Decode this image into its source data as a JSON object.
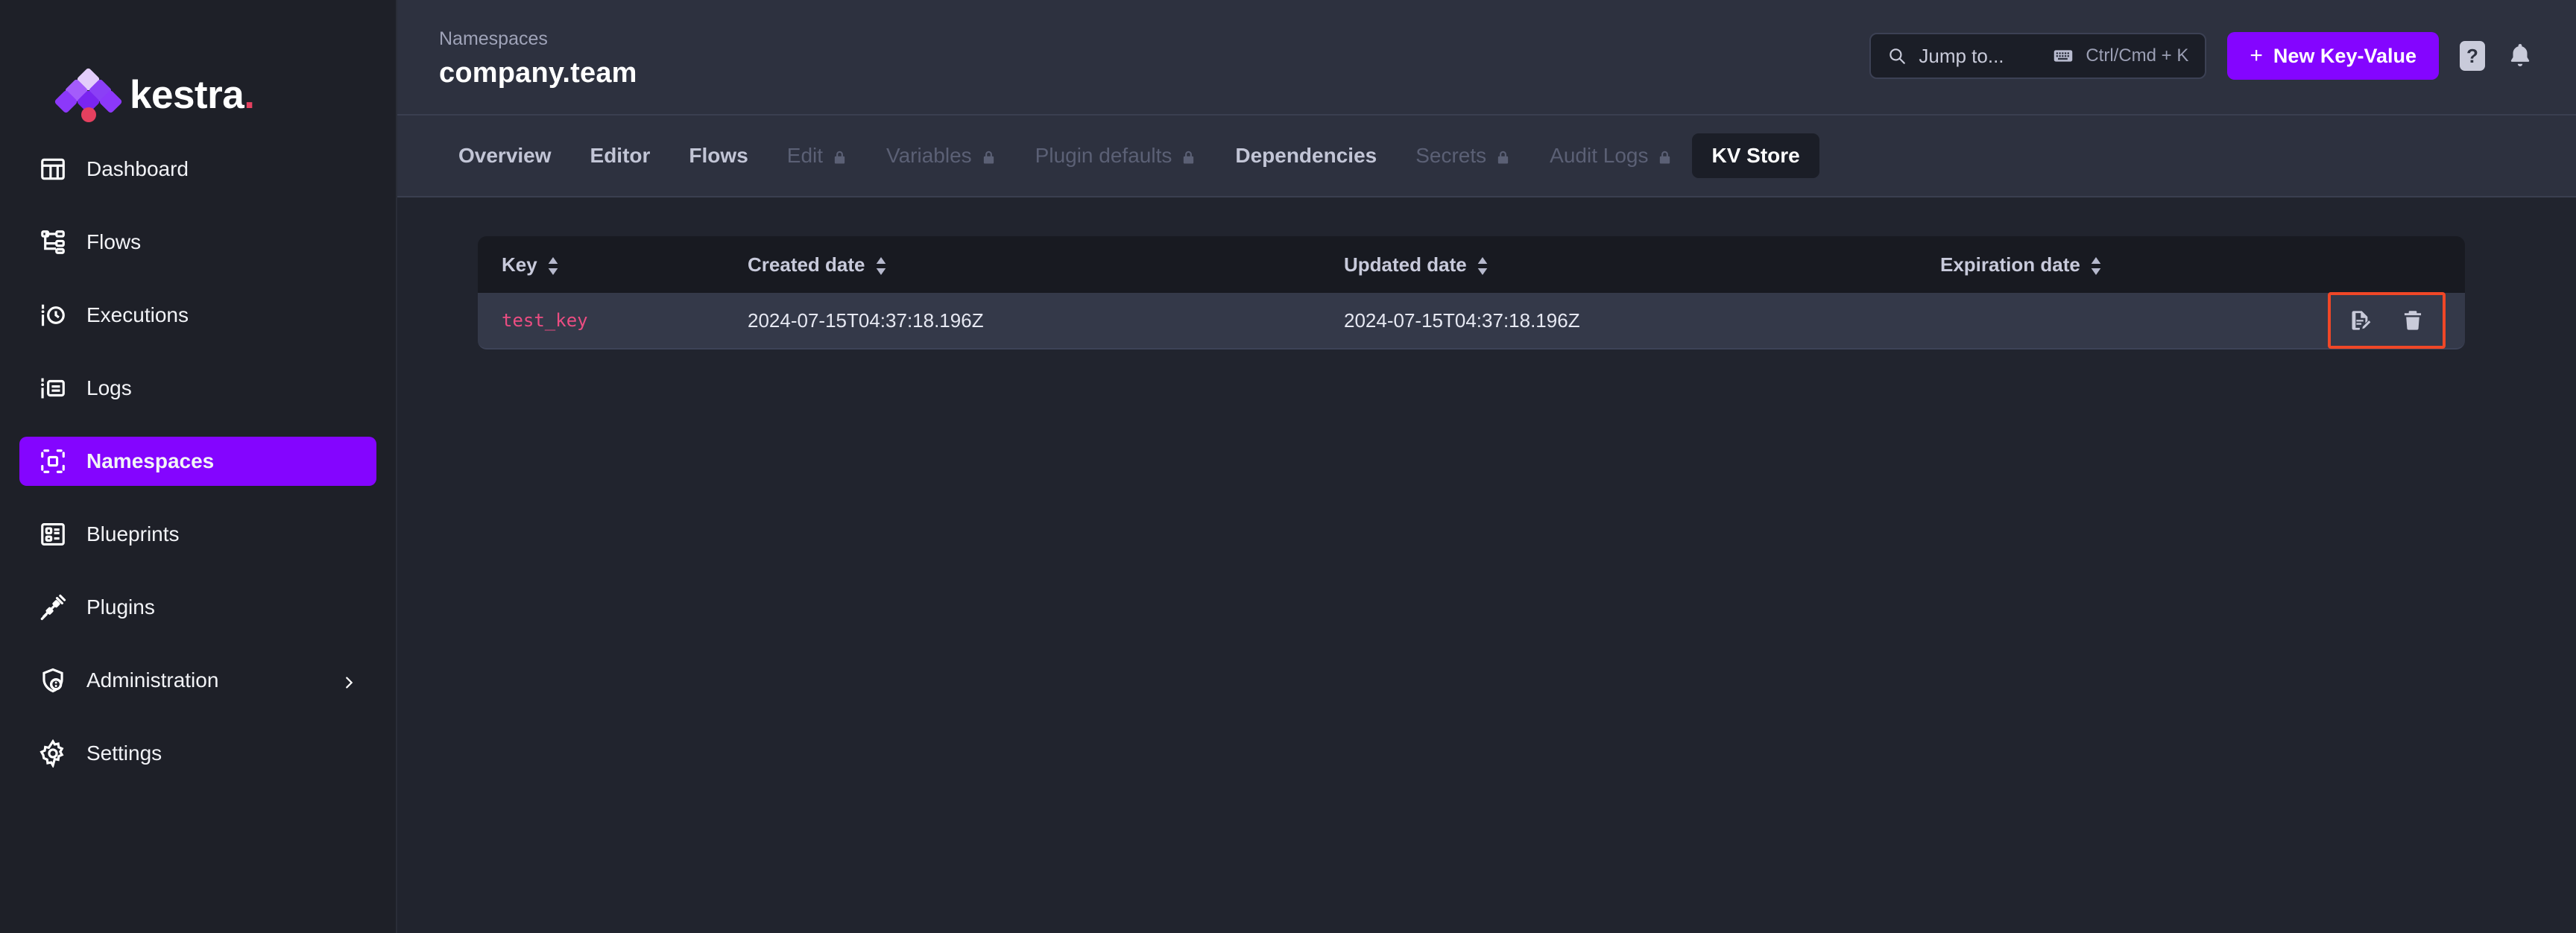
{
  "brand": {
    "name": "kestra",
    "accent_purple": "#8405ff",
    "accent_pink": "#e5405f"
  },
  "sidebar": {
    "items": [
      {
        "label": "Dashboard",
        "icon": "dashboard-icon",
        "active": false,
        "chevron": false
      },
      {
        "label": "Flows",
        "icon": "flows-icon",
        "active": false,
        "chevron": false
      },
      {
        "label": "Executions",
        "icon": "executions-icon",
        "active": false,
        "chevron": false
      },
      {
        "label": "Logs",
        "icon": "logs-icon",
        "active": false,
        "chevron": false
      },
      {
        "label": "Namespaces",
        "icon": "namespaces-icon",
        "active": true,
        "chevron": false
      },
      {
        "label": "Blueprints",
        "icon": "blueprints-icon",
        "active": false,
        "chevron": false
      },
      {
        "label": "Plugins",
        "icon": "plugins-icon",
        "active": false,
        "chevron": false
      },
      {
        "label": "Administration",
        "icon": "administration-icon",
        "active": false,
        "chevron": true
      },
      {
        "label": "Settings",
        "icon": "settings-icon",
        "active": false,
        "chevron": false
      }
    ]
  },
  "header": {
    "breadcrumb": "Namespaces",
    "title": "company.team",
    "search": {
      "placeholder": "Jump to...",
      "shortcut": "Ctrl/Cmd + K",
      "value": ""
    },
    "new_button_label": "New Key-Value",
    "new_button_plus": "+",
    "help_label": "?",
    "notifications_icon": "bell-icon"
  },
  "tabs": [
    {
      "label": "Overview",
      "locked": false,
      "active": false
    },
    {
      "label": "Editor",
      "locked": false,
      "active": false
    },
    {
      "label": "Flows",
      "locked": false,
      "active": false
    },
    {
      "label": "Edit",
      "locked": true,
      "active": false
    },
    {
      "label": "Variables",
      "locked": true,
      "active": false
    },
    {
      "label": "Plugin defaults",
      "locked": true,
      "active": false
    },
    {
      "label": "Dependencies",
      "locked": false,
      "active": false
    },
    {
      "label": "Secrets",
      "locked": true,
      "active": false
    },
    {
      "label": "Audit Logs",
      "locked": true,
      "active": false
    },
    {
      "label": "KV Store",
      "locked": false,
      "active": true
    }
  ],
  "table": {
    "columns": [
      {
        "label": "Key",
        "sortable": true
      },
      {
        "label": "Created date",
        "sortable": true
      },
      {
        "label": "Updated date",
        "sortable": true
      },
      {
        "label": "Expiration date",
        "sortable": true
      }
    ],
    "rows": [
      {
        "key": "test_key",
        "created_date": "2024-07-15T04:37:18.196Z",
        "updated_date": "2024-07-15T04:37:18.196Z",
        "expiration_date": "",
        "actions": [
          {
            "name": "edit-key-value-button",
            "icon": "file-edit-icon"
          },
          {
            "name": "delete-key-value-button",
            "icon": "trash-icon"
          }
        ]
      }
    ],
    "highlight_color": "#f04727"
  }
}
